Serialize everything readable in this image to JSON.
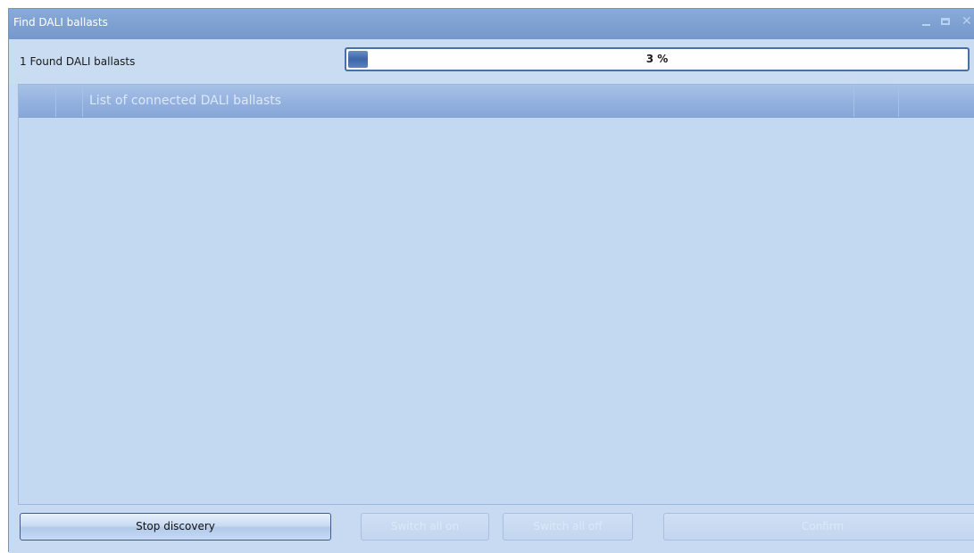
{
  "window": {
    "title": "Find DALI ballasts",
    "controls": {
      "minimize": "minimize-icon",
      "maximize": "maximize-icon",
      "close": "close-icon"
    }
  },
  "status": {
    "found_text": "1 Found DALI ballasts",
    "progress_label": "3 %",
    "progress_value": 0.03
  },
  "grid": {
    "header_title": "List of connected DALI ballasts",
    "rows": []
  },
  "buttons": {
    "stop": "Stop discovery",
    "switch_on": "Switch all on",
    "switch_off": "Switch all off",
    "confirm": "Confirm"
  },
  "colors": {
    "accent": "#4a6fa5",
    "background": "#c7daf1",
    "titlebar": "#7ea0d1"
  }
}
